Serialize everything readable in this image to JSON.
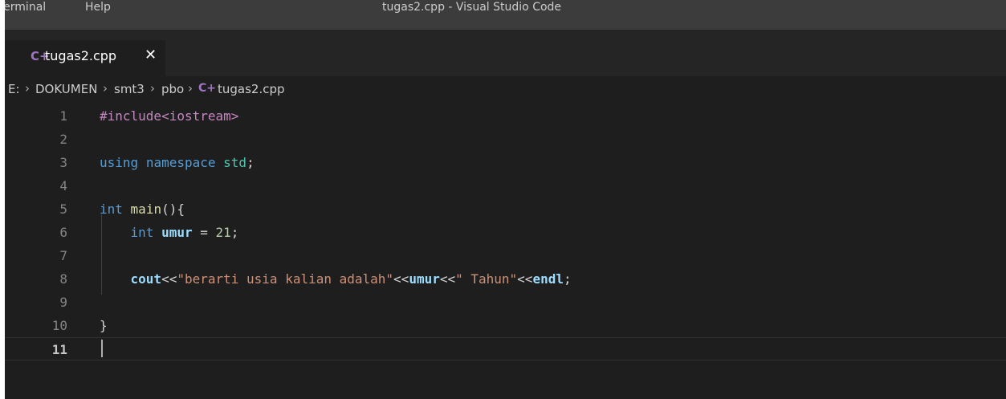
{
  "window": {
    "title": "tugas2.cpp - Visual Studio Code",
    "menu": [
      "Terminal",
      "Help"
    ]
  },
  "tab": {
    "icon": "cpp-file-icon",
    "icon_glyph": "C+",
    "label": "tugas2.cpp",
    "close_glyph": "✕"
  },
  "breadcrumbs": {
    "items": [
      "E:",
      "DOKUMEN",
      "smt3",
      "pbo",
      "tugas2.cpp"
    ],
    "separator": "›"
  },
  "editor": {
    "current_line": 11,
    "line_numbers": [
      "1",
      "2",
      "3",
      "4",
      "5",
      "6",
      "7",
      "8",
      "9",
      "10",
      "11"
    ],
    "lines": [
      [
        {
          "t": "#include<iostream>",
          "k": "pre"
        }
      ],
      [],
      [
        {
          "t": "using",
          "k": "kw"
        },
        {
          "t": " ",
          "k": "op"
        },
        {
          "t": "namespace",
          "k": "kw"
        },
        {
          "t": " ",
          "k": "op"
        },
        {
          "t": "std",
          "k": "ns"
        },
        {
          "t": ";",
          "k": "op"
        }
      ],
      [],
      [
        {
          "t": "int",
          "k": "kw"
        },
        {
          "t": " ",
          "k": "op"
        },
        {
          "t": "main",
          "k": "fn"
        },
        {
          "t": "(){",
          "k": "op"
        }
      ],
      [
        {
          "t": "    ",
          "k": "op"
        },
        {
          "t": "int",
          "k": "kw"
        },
        {
          "t": " ",
          "k": "op"
        },
        {
          "t": "umur",
          "k": "var"
        },
        {
          "t": " = ",
          "k": "op"
        },
        {
          "t": "21",
          "k": "num"
        },
        {
          "t": ";",
          "k": "op"
        }
      ],
      [],
      [
        {
          "t": "    ",
          "k": "op"
        },
        {
          "t": "cout",
          "k": "var"
        },
        {
          "t": "<<",
          "k": "op"
        },
        {
          "t": "\"berarti usia kalian adalah\"",
          "k": "str"
        },
        {
          "t": "<<",
          "k": "op"
        },
        {
          "t": "umur",
          "k": "var"
        },
        {
          "t": "<<",
          "k": "op"
        },
        {
          "t": "\" Tahun\"",
          "k": "str"
        },
        {
          "t": "<<",
          "k": "op"
        },
        {
          "t": "endl",
          "k": "var"
        },
        {
          "t": ";",
          "k": "op"
        }
      ],
      [],
      [
        {
          "t": "}",
          "k": "op"
        }
      ],
      []
    ]
  },
  "colors": {
    "editor_bg": "#1e1e1e",
    "titlebar_bg": "#3c3c3c",
    "tabbar_bg": "#252526",
    "keyword": "#569cd6",
    "preprocessor": "#c586c0",
    "string": "#ce9178",
    "number": "#b5cea8",
    "variable": "#9cdcfe",
    "function": "#dcdcaa",
    "namespace": "#4ec9b0",
    "cpp_icon": "#a074c4"
  }
}
